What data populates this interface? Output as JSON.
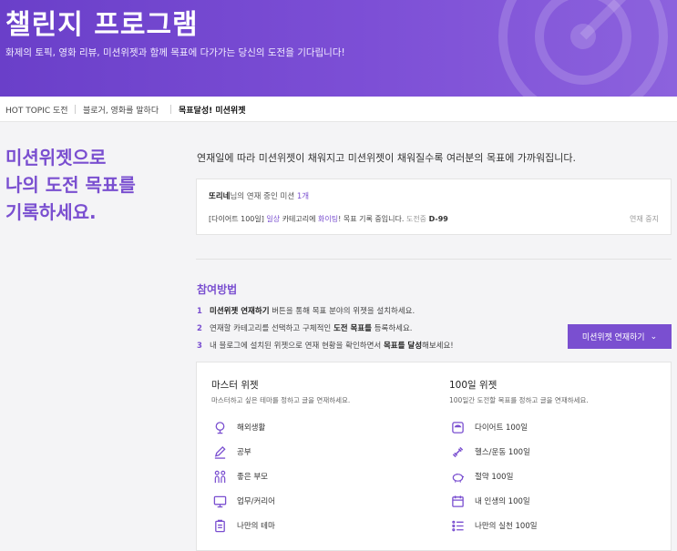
{
  "hero": {
    "title": "챌린지 프로그램",
    "subtitle": "화제의 토픽, 영화 리뷰, 미션위젯과 함께 목표에 다가가는 당신의 도전을 기다립니다!"
  },
  "nav": {
    "items": [
      "HOT TOPIC 도전",
      "블로거, 영화를 말하다",
      "목표달성! 미션위젯"
    ],
    "active_index": 2
  },
  "lead": {
    "line1": "미션위젯으로",
    "line2": "나의 도전 목표를",
    "line3": "기록하세요."
  },
  "description": "연재일에 따라 미션위젯이 채워지고 미션위젯이 채워질수록 여러분의 목표에 가까워집니다.",
  "status_card": {
    "user": "또리네",
    "text_after_user": "님의 연재 중인 미션",
    "count": "1개",
    "mission_prefix": "[다이어트 100일]",
    "category": "일상",
    "category_suffix": "카테고리에",
    "cheer": "화이팅",
    "mission_suffix": "! 목표 기록 중입니다.",
    "progress_label": "도전중",
    "progress_value": "D-99",
    "stop_link": "연재 중지"
  },
  "how_to": {
    "title": "참여방법",
    "steps": [
      {
        "num": "1",
        "bold": "미션위젯 연재하기",
        "text": "버튼을 통해 목표 분야의 위젯을 설치하세요."
      },
      {
        "num": "2",
        "pre": "연재할 카테고리를 선택하고 구체적인",
        "bold": "도전 목표를",
        "text": "등록하세요."
      },
      {
        "num": "3",
        "pre": "내 블로그에 설치된 위젯으로 연재 현황을 확인하면서",
        "bold": "목표를 달성",
        "text": "해보세요!"
      }
    ]
  },
  "cta": {
    "label": "미션위젯 연재하기"
  },
  "widgets": {
    "master": {
      "title": "마스터 위젯",
      "subtitle": "마스터하고 싶은 테마를 정하고 글을 연재하세요.",
      "items": [
        {
          "label": "해외생활",
          "icon": "globe-pin-icon"
        },
        {
          "label": "공부",
          "icon": "pencil-icon"
        },
        {
          "label": "좋은 부모",
          "icon": "family-icon"
        },
        {
          "label": "업무/커리어",
          "icon": "monitor-icon"
        },
        {
          "label": "나만의 테마",
          "icon": "clipboard-icon"
        }
      ]
    },
    "hundred": {
      "title": "100일 위젯",
      "subtitle": "100일간 도전할 목표를 정하고 글을 연재하세요.",
      "items": [
        {
          "label": "다이어트 100일",
          "icon": "scale-icon"
        },
        {
          "label": "헬스/운동 100일",
          "icon": "dumbbell-icon"
        },
        {
          "label": "절약 100일",
          "icon": "piggy-bank-icon"
        },
        {
          "label": "내 인생의 100일",
          "icon": "calendar-icon"
        },
        {
          "label": "나만의 실천 100일",
          "icon": "checklist-icon"
        }
      ]
    }
  },
  "colors": {
    "accent": "#7a4fd0",
    "hero_start": "#6a3fc9",
    "hero_end": "#8c62dd"
  }
}
